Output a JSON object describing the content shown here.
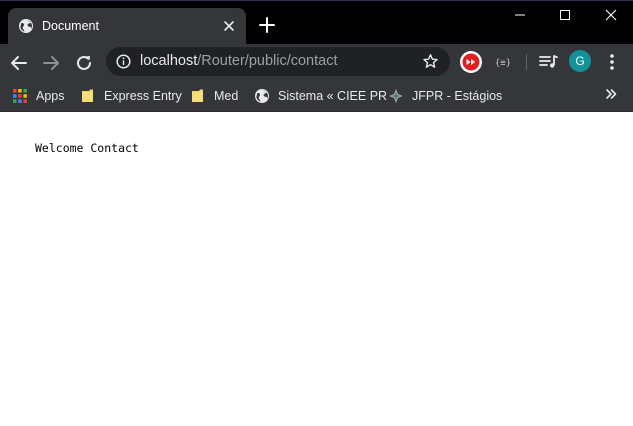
{
  "browser": {
    "tab": {
      "title": "Document",
      "favicon": "globe-icon"
    },
    "window_controls": [
      "minimize-icon",
      "maximize-icon",
      "close-icon"
    ]
  },
  "omnibox": {
    "url_host": "localhost",
    "url_path": "/Router/public/contact"
  },
  "profile": {
    "initial": "G",
    "color": "#12939a"
  },
  "bookmarks": [
    {
      "label": "Apps",
      "icon": "apps-grid-icon"
    },
    {
      "label": "Express Entry",
      "icon": "folder-icon"
    },
    {
      "label": "Med",
      "icon": "folder-icon"
    },
    {
      "label": "Sistema « CIEE PR",
      "icon": "globe-icon"
    },
    {
      "label": "JFPR - Estágios",
      "icon": "jfpr-icon"
    }
  ],
  "page": {
    "content": "Welcome Contact"
  },
  "colors": {
    "titlebar": "#000000",
    "toolbar": "#35363a",
    "omnibox": "#202124",
    "folder": "#f5d46b",
    "youtube_ext": "#e02020"
  }
}
